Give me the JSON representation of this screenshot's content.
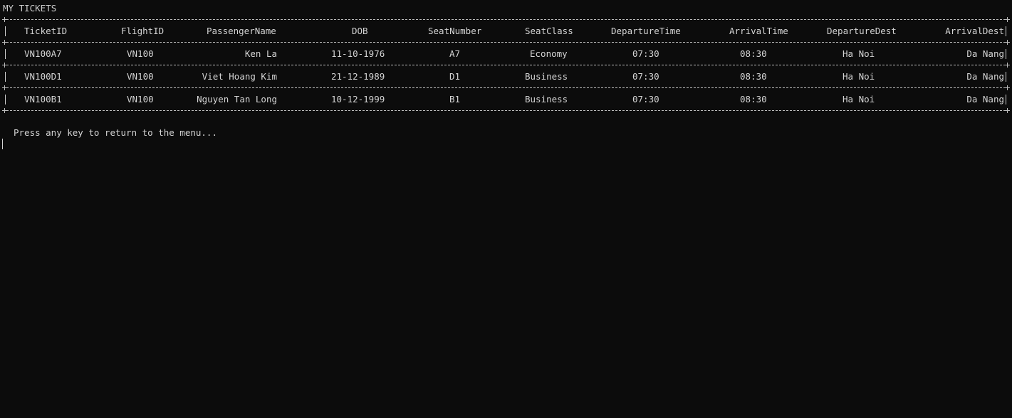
{
  "title": "MY TICKETS",
  "table": {
    "headers": [
      "TicketID",
      "FlightID",
      "PassengerName",
      "DOB",
      "SeatNumber",
      "SeatClass",
      "DepartureTime",
      "ArrivalTime",
      "DepartureDest",
      "ArrivalDest"
    ],
    "rows": [
      [
        "VN100A7",
        "VN100",
        "Ken La",
        "11-10-1976",
        "A7",
        "Economy",
        "07:30",
        "08:30",
        "Ha Noi",
        "Da Nang"
      ],
      [
        "VN100D1",
        "VN100",
        "Viet Hoang Kim",
        "21-12-1989",
        "D1",
        "Business",
        "07:30",
        "08:30",
        "Ha Noi",
        "Da Nang"
      ],
      [
        "VN100B1",
        "VN100",
        "Nguyen Tan Long",
        "10-12-1999",
        "B1",
        "Business",
        "07:30",
        "08:30",
        "Ha Noi",
        "Da Nang"
      ]
    ]
  },
  "prompt": "Press any key to return to the menu..."
}
